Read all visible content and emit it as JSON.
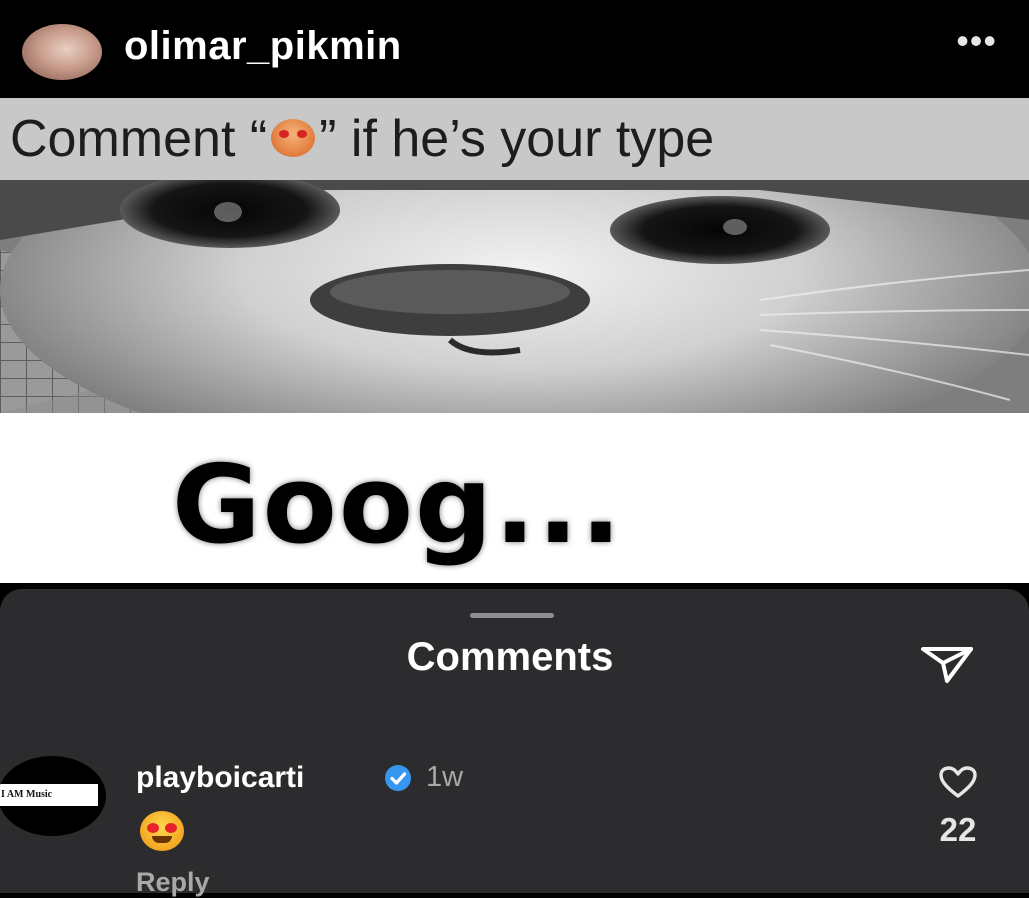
{
  "post": {
    "username": "olimar_pikmin",
    "more_icon": "more-horizontal-icon",
    "caption_before": "Comment “",
    "caption_emoji": "smiling-face-with-heart-eyes",
    "caption_after": "” if he’s your type",
    "meme_text": "Goog..."
  },
  "comments_sheet": {
    "title": "Comments",
    "share_icon": "paper-plane-icon",
    "comments": [
      {
        "avatar_text": "I AM Music",
        "username": "playboicarti",
        "verified": true,
        "time": "1w",
        "emoji": "smiling-face-with-heart-eyes",
        "reply_label": "Reply",
        "like_count": "22"
      }
    ]
  },
  "colors": {
    "header_bg": "#000000",
    "caption_bg": "#c8c8c8",
    "sheet_bg": "#2c2c2e",
    "verified_blue": "#3797f0",
    "muted_text": "#a8a8a8"
  }
}
